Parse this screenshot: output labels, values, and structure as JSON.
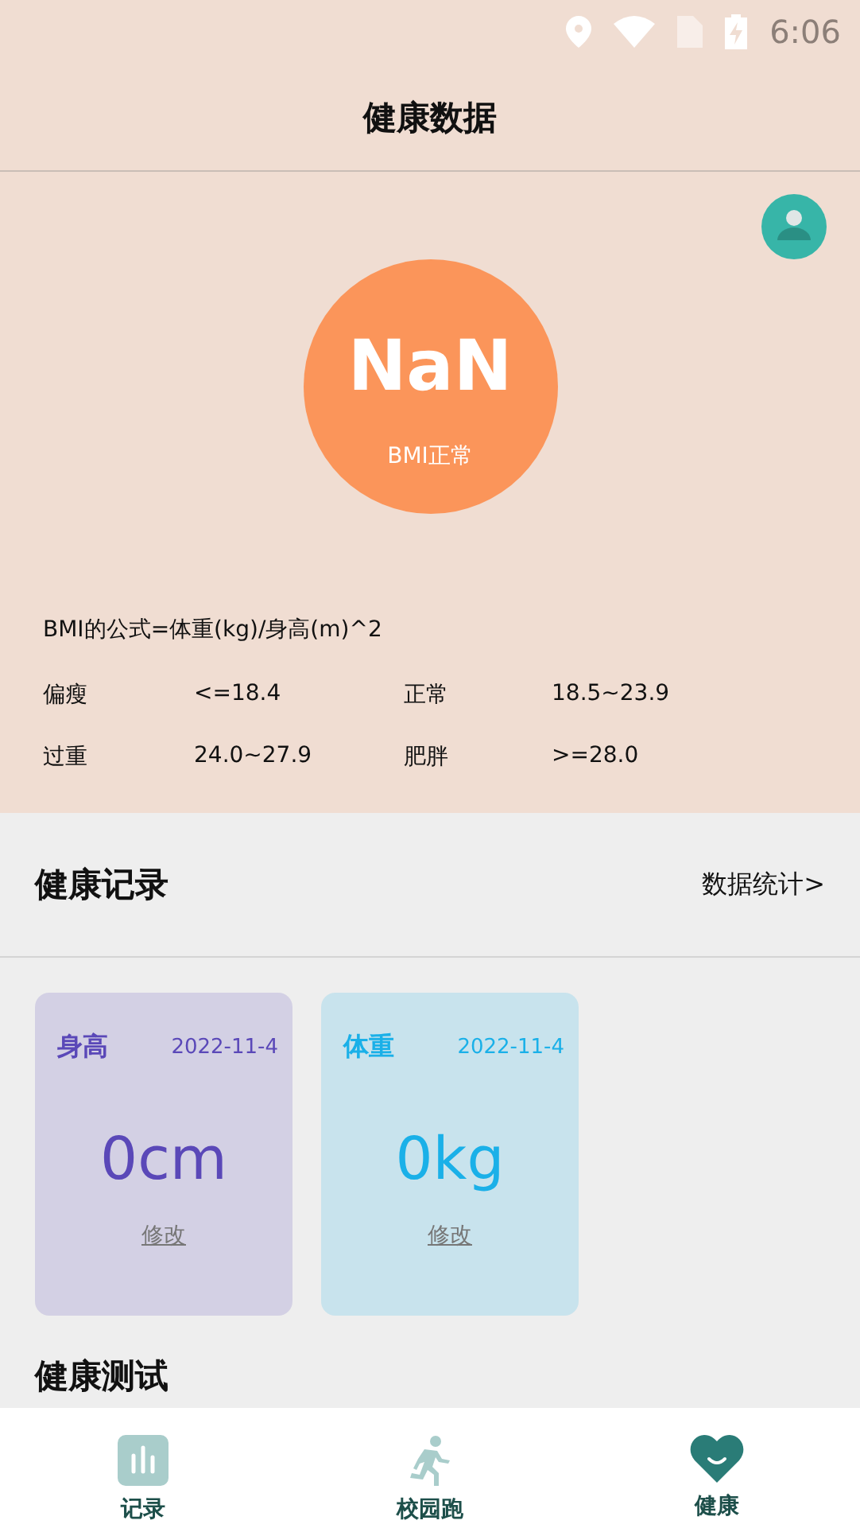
{
  "status_bar": {
    "time": "6:06"
  },
  "header": {
    "title": "健康数据"
  },
  "bmi": {
    "value": "NaN",
    "status": "BMI正常",
    "formula": "BMI的公式=体重(kg)/身高(m)^2",
    "ranges": [
      {
        "label": "偏瘦",
        "value": "<=18.4"
      },
      {
        "label": "正常",
        "value": "18.5~23.9"
      },
      {
        "label": "过重",
        "value": "24.0~27.9"
      },
      {
        "label": "肥胖",
        "value": ">=28.0"
      }
    ]
  },
  "records": {
    "title": "健康记录",
    "link": "数据统计>",
    "cards": [
      {
        "label": "身高",
        "date": "2022-11-4",
        "value": "0cm",
        "action": "修改",
        "color": "#5a48b8"
      },
      {
        "label": "体重",
        "date": "2022-11-4",
        "value": "0kg",
        "action": "修改",
        "color": "#1ab0e8"
      }
    ]
  },
  "tests": {
    "title": "健康测试"
  },
  "nav": [
    {
      "label": "记录",
      "kind": "chart",
      "selected": false
    },
    {
      "label": "校园跑",
      "kind": "run",
      "selected": false
    },
    {
      "label": "健康",
      "kind": "heart",
      "selected": true
    }
  ]
}
